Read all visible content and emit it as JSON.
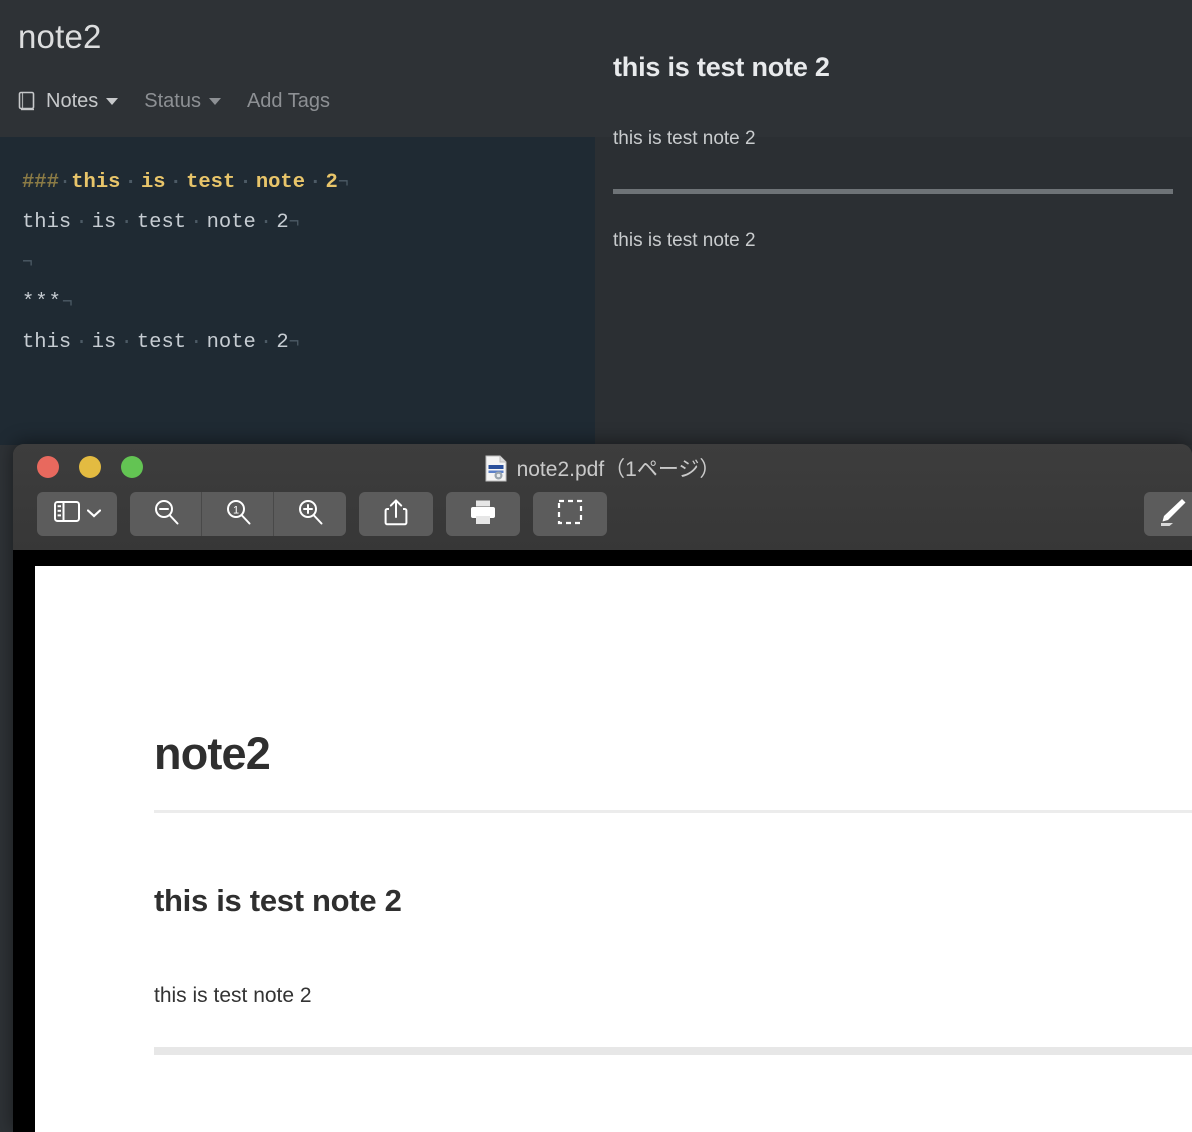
{
  "note_app": {
    "title": "note2",
    "properties": [
      {
        "name": "notes",
        "label": "Notes",
        "icon": "book-icon",
        "has_caret": true,
        "dim": false
      },
      {
        "name": "status",
        "label": "Status",
        "icon": null,
        "has_caret": true,
        "dim": true
      },
      {
        "name": "tags",
        "label": "Add Tags",
        "icon": null,
        "has_caret": false,
        "dim": true
      }
    ],
    "editor": {
      "line1_hashes": "###",
      "line1_text": "this is test note 2",
      "line2_text": "this is test note 2",
      "line3_text": "",
      "line4_text": "***",
      "line5_text": "this is test note 2",
      "space_marker": "·",
      "newline_marker": "¬"
    },
    "preview": {
      "heading": "this is test note 2",
      "paragraph1": "this is test note 2",
      "paragraph2": "this is test note 2",
      "hr_color": "#6e7377"
    }
  },
  "preview_window": {
    "title": "note2.pdf（1ページ）",
    "traffic_lights": [
      {
        "name": "close",
        "color": "#e8695e"
      },
      {
        "name": "minimize",
        "color": "#e3bb41"
      },
      {
        "name": "zoom",
        "color": "#63c453"
      }
    ],
    "toolbar": [
      {
        "name": "sidebar-toggle",
        "icon": "sidebar-icon",
        "label": ""
      },
      {
        "name": "zoom-out",
        "icon": "zoom-out-icon",
        "label": ""
      },
      {
        "name": "actual-size",
        "icon": "actual-size-icon",
        "label": "1"
      },
      {
        "name": "zoom-in",
        "icon": "zoom-in-icon",
        "label": ""
      },
      {
        "name": "share",
        "icon": "share-icon",
        "label": ""
      },
      {
        "name": "print",
        "icon": "print-icon",
        "label": ""
      },
      {
        "name": "select",
        "icon": "selection-icon",
        "label": ""
      },
      {
        "name": "markup",
        "icon": "markup-pen-icon",
        "label": ""
      }
    ],
    "document": {
      "title": "note2",
      "heading": "this is test note 2",
      "paragraph": "this is test note 2"
    }
  }
}
